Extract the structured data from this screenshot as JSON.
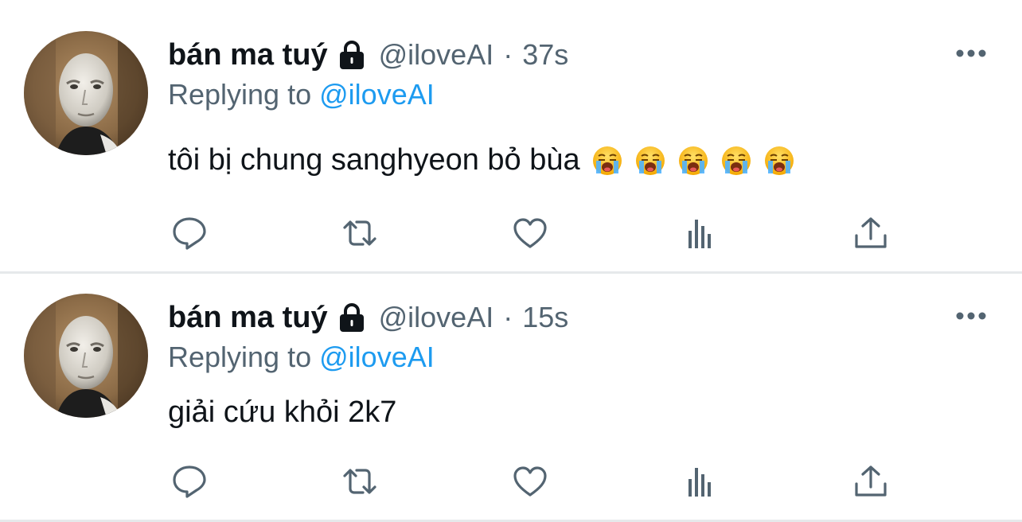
{
  "tweets": [
    {
      "author_name": "bán ma tuý",
      "handle": "@iloveAI",
      "separator": "·",
      "time": "37s",
      "replying_prefix": "Replying to",
      "replying_to": "@iloveAI",
      "text": "tôi bị chung sanghyeon bỏ bùa",
      "emojis": [
        "loudly-crying-face",
        "loudly-crying-face",
        "loudly-crying-face",
        "loudly-crying-face",
        "loudly-crying-face"
      ]
    },
    {
      "author_name": "bán ma tuý",
      "handle": "@iloveAI",
      "separator": "·",
      "time": "15s",
      "replying_prefix": "Replying to",
      "replying_to": "@iloveAI",
      "text": "giải cứu khỏi 2k7",
      "emojis": []
    }
  ],
  "icons": {
    "lock": "lock-icon",
    "more": "more-icon",
    "reply": "reply-icon",
    "retweet": "retweet-icon",
    "like": "heart-icon",
    "analytics": "analytics-icon",
    "share": "share-icon"
  },
  "colors": {
    "text": "#0f1419",
    "secondary": "#536471",
    "link": "#1d9bf0",
    "separator": "#e6e9eb"
  }
}
